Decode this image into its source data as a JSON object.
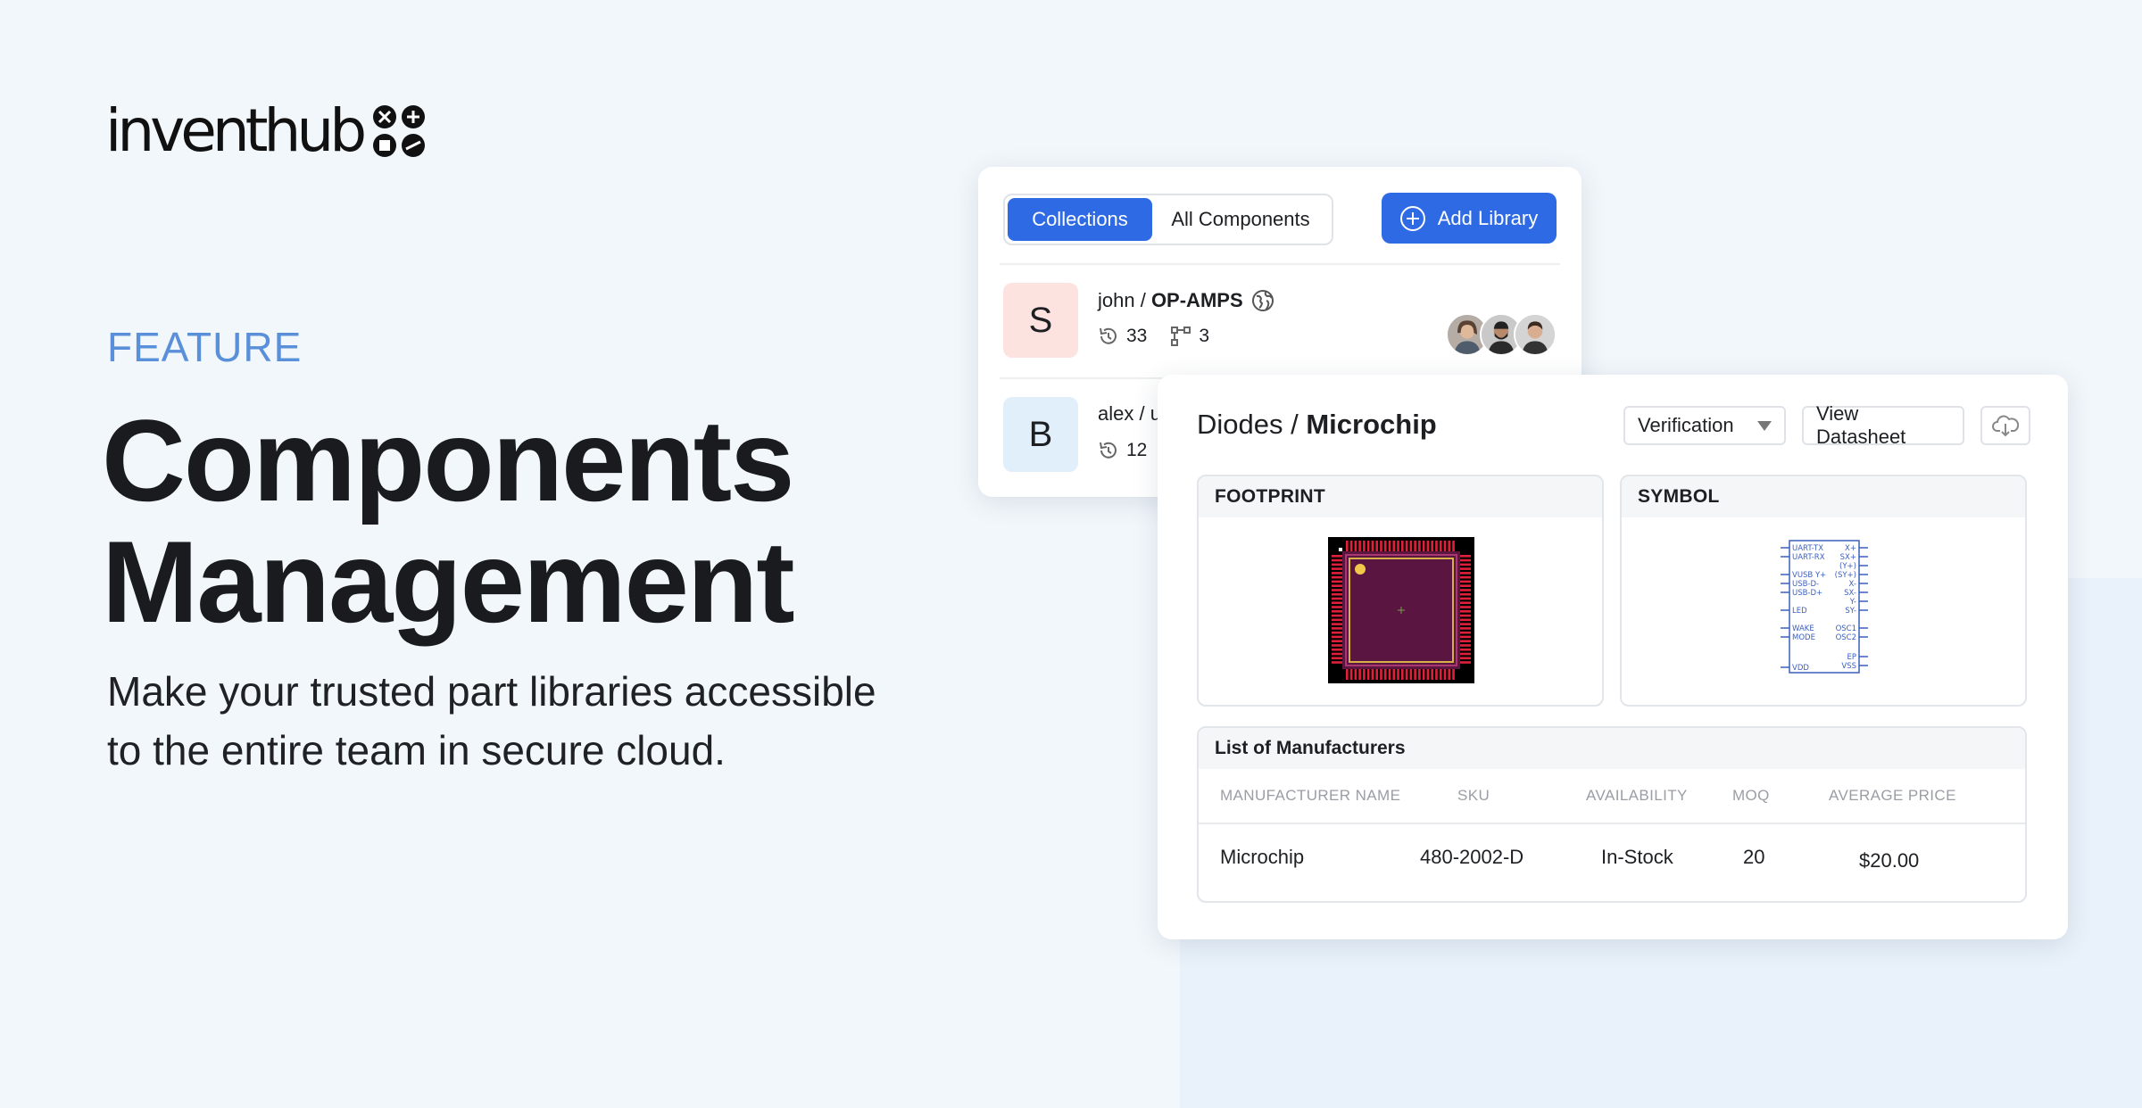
{
  "brand": {
    "name": "inventhub",
    "logo_icon": "component-symbols-icon"
  },
  "hero": {
    "eyebrow": "FEATURE",
    "title_line1": "Components",
    "title_line2": "Management",
    "subtitle_line1": "Make your trusted part libraries accessible",
    "subtitle_line2": "to the entire team in secure cloud."
  },
  "libraries_card": {
    "tabs": [
      {
        "label": "Collections",
        "active": true
      },
      {
        "label": "All Components",
        "active": false
      }
    ],
    "add_button": {
      "label": "Add Library",
      "icon": "plus-circle-icon"
    },
    "rows": [
      {
        "avatar_letter": "S",
        "avatar_color": "#fde3df",
        "owner": "john / ",
        "name": "OP-AMPS",
        "visibility_icon": "globe-icon",
        "history_count": "33",
        "branch_count": "3"
      },
      {
        "avatar_letter": "B",
        "avatar_color": "#e1effb",
        "owner": "alex / u",
        "name": "",
        "history_count": "12"
      }
    ]
  },
  "detail_card": {
    "category": "Diodes / ",
    "manufacturer": "Microchip",
    "status_select": "Verification",
    "datasheet_button": "View Datasheet",
    "download_icon": "cloud-download-icon",
    "footprint_label": "FOOTPRINT",
    "symbol_label": "SYMBOL",
    "symbol_pins_left": [
      "UART-TX",
      "UART-RX",
      "VUSB Y+",
      "USB-D-",
      "USB-D+",
      "LED",
      "WAKE",
      "MODE",
      "VDD"
    ],
    "symbol_pins_right": [
      "X+",
      "SX+",
      "(Y+)",
      "(SY+)",
      "X-",
      "SX-",
      "Y-",
      "SY-",
      "OSC1",
      "OSC2",
      "EP",
      "VSS"
    ],
    "manufacturers": {
      "title": "List of Manufacturers",
      "columns": [
        "MANUFACTURER NAME",
        "SKU",
        "AVAILABILITY",
        "MOQ",
        "AVERAGE PRICE"
      ],
      "rows": [
        [
          "Microchip",
          "480-2002-D",
          "In-Stock",
          "20",
          "$20.00"
        ]
      ]
    }
  },
  "colors": {
    "primary": "#2f6ae5",
    "eyebrow": "#5a8fd9"
  }
}
